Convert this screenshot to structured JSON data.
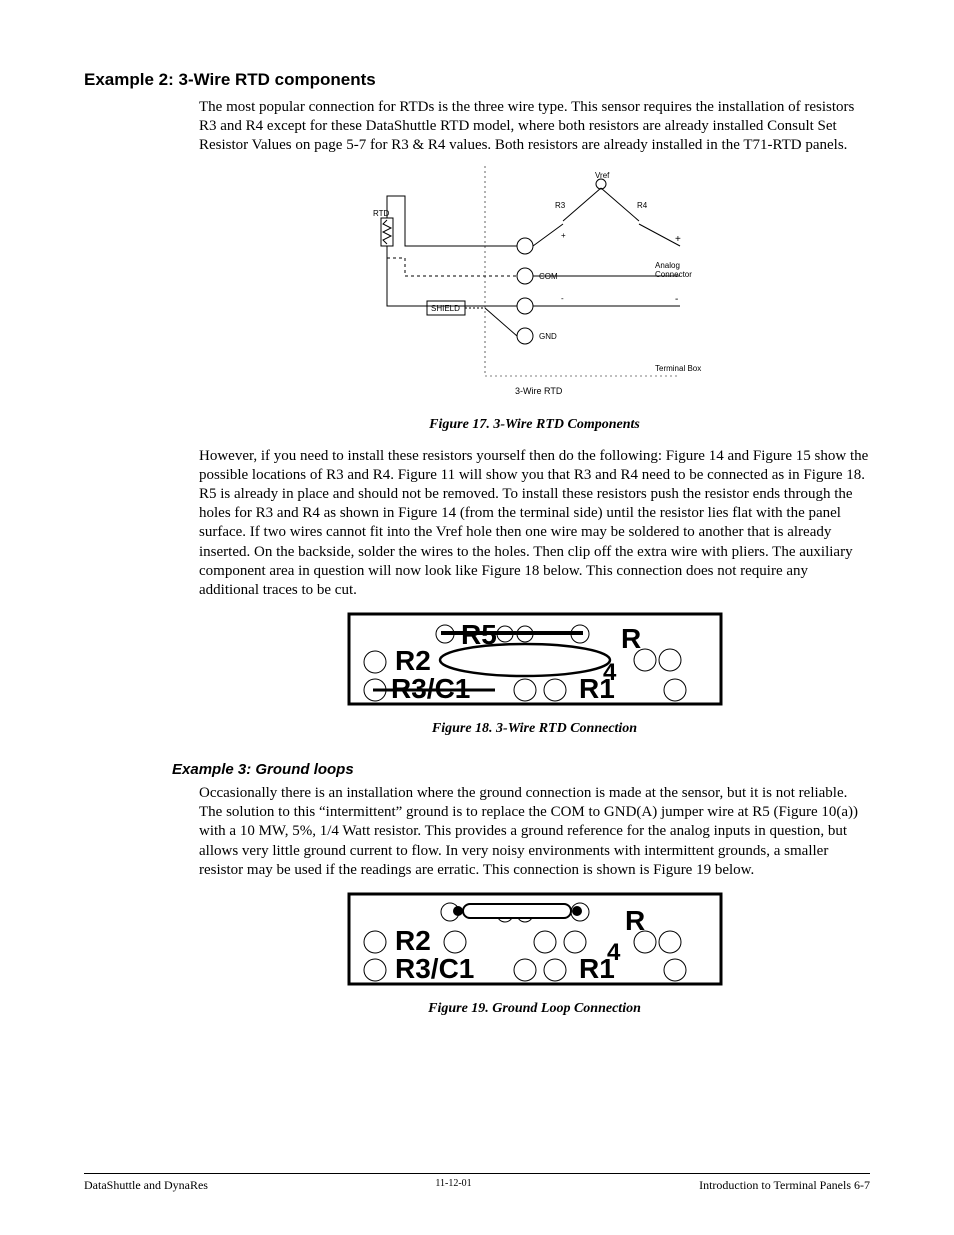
{
  "example2": {
    "title": "Example 2: 3-Wire RTD components",
    "p1": "The most popular connection for RTDs is the three wire type. This sensor requires the installation of resistors R3 and R4 except for these DataShuttle RTD model, where both resistors are already installed Consult Set Resistor Values on page 5-7 for R3 & R4 values.  Both resistors are already installed in the T71-RTD panels.",
    "fig17_caption": "Figure 17.   3-Wire RTD Components",
    "p2": "However, if you need to install these resistors yourself then do the following: Figure 14 and Figure 15 show the possible locations of R3 and R4. Figure 11 will show you that R3 and R4 need to be connected as in Figure 18. R5 is already in place and should not be removed. To install these resistors push the resistor ends through the holes for R3 and R4 as shown in Figure 14 (from the terminal side) until the resistor lies flat with the panel surface. If two wires cannot fit into the Vref hole then one wire may be soldered to another that is already inserted. On the backside, solder the wires to the holes. Then clip off the extra wire with pliers. The auxiliary component area in question will now look like Figure 18 below. This connection does not require any additional traces to be cut.",
    "fig18_caption": "Figure 18.   3-Wire RTD Connection"
  },
  "example3": {
    "title": "Example 3: Ground loops",
    "p1": "Occasionally there is an installation where the ground connection is made at the sensor, but it is not reliable. The solution to this “intermittent” ground is to replace the COM to GND(A) jumper wire at R5 (Figure 10(a)) with a 10 MW, 5%, 1/4 Watt resistor. This provides a ground reference for the analog inputs in question, but allows very little ground current to flow. In very noisy environments with intermittent grounds, a smaller resistor may be used if the readings are erratic. This connection is shown is Figure 19 below.",
    "fig19_caption": "Figure 19.   Ground Loop Connection"
  },
  "diagram17": {
    "vref_label": "Vref",
    "r3_label": "R3",
    "r4_label": "R4",
    "rtd_label": "RTD",
    "plus_label": "+",
    "com_label": "COM",
    "minus_label": "-",
    "gnd_label": "GND",
    "shield_label": "SHIELD",
    "analog_conn_label1": "Analog",
    "analog_conn_label2": "Connector",
    "termbox_label": "Terminal Box",
    "title_label": "3-Wire RTD"
  },
  "diagram18": {
    "r5_label": "R5",
    "r_label": "R",
    "r2_label": "R2",
    "four_label": "4",
    "r3c1_label": "R3/C1",
    "r1_label": "R1"
  },
  "diagram19": {
    "r_label": "R",
    "r2_label": "R2",
    "four_label": "4",
    "r3c1_label": "R3/C1",
    "r1_label": "R1"
  },
  "footer": {
    "left": "DataShuttle and DynaRes",
    "mid": "11-12-01",
    "right": "Introduction to Terminal Panels   6-7"
  }
}
